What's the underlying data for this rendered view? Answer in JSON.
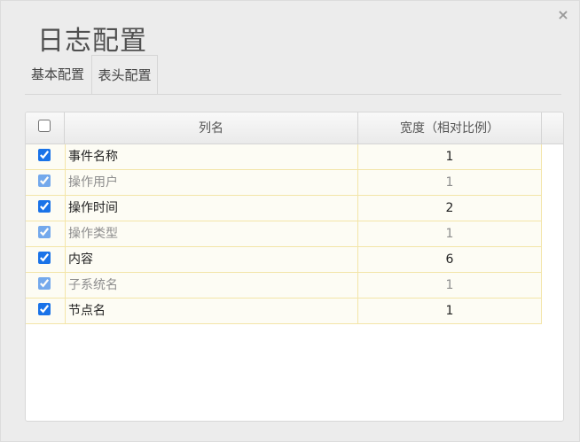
{
  "dialog": {
    "title": "日志配置",
    "close_glyph": "×"
  },
  "tabs": [
    {
      "label": "基本配置",
      "active": false
    },
    {
      "label": "表头配置",
      "active": true
    }
  ],
  "table": {
    "headers": {
      "select_all_checked": false,
      "column_name": "列名",
      "width": "宽度（相对比例）"
    },
    "rows": [
      {
        "checked": true,
        "name": "事件名称",
        "width": "1",
        "disabled": false
      },
      {
        "checked": true,
        "name": "操作用户",
        "width": "1",
        "disabled": true
      },
      {
        "checked": true,
        "name": "操作时间",
        "width": "2",
        "disabled": false
      },
      {
        "checked": true,
        "name": "操作类型",
        "width": "1",
        "disabled": true
      },
      {
        "checked": true,
        "name": "内容",
        "width": "6",
        "disabled": false
      },
      {
        "checked": true,
        "name": "子系统名",
        "width": "1",
        "disabled": true
      },
      {
        "checked": true,
        "name": "节点名",
        "width": "1",
        "disabled": false
      }
    ]
  },
  "colors": {
    "checkbox_accent": "#1a73e8",
    "row_border": "#f3e5a8",
    "row_background": "#fdfcf4"
  }
}
